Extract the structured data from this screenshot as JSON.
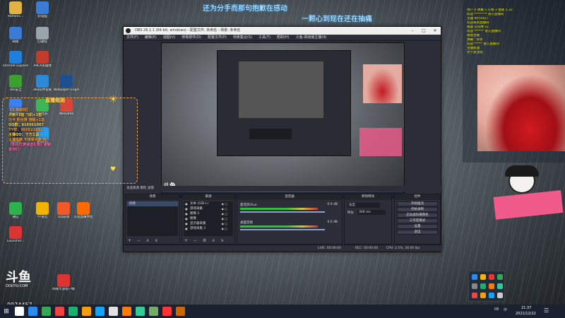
{
  "desktop": {
    "icons": [
      {
        "label": "Adminis…",
        "color": "#e3b341"
      },
      {
        "label": "此电脑",
        "color": "#3a7bd5"
      },
      {
        "label": "网络",
        "color": "#3a7bd5"
      },
      {
        "label": "回收站",
        "color": "#9aa4ad"
      },
      {
        "label": "Internet Explorer",
        "color": "#1e7fdc"
      },
      {
        "label": "APEX英雄地",
        "color": "#c23b2b"
      },
      {
        "label": "360安全",
        "color": "#3ba12e"
      },
      {
        "label": "360软件管家",
        "color": "#2d8ad8"
      },
      {
        "label": "Wallpaper Engine",
        "color": "#1d4f91"
      },
      {
        "label": "腾讯会议",
        "color": "#2f7bf0"
      },
      {
        "label": "QQ音乐",
        "color": "#33b34a"
      },
      {
        "label": "WeGame",
        "color": "#d43d2f"
      },
      {
        "label": "Steam",
        "color": "#1b2838"
      },
      {
        "label": "腾讯QQ",
        "color": "#1f97e8"
      },
      {
        "label": "微信",
        "color": "#2bb24c"
      },
      {
        "label": "YY语音",
        "color": "#f0b400"
      },
      {
        "label": "QQ游戏",
        "color": "#f05a28"
      },
      {
        "label": "斗鱼直播伴侣",
        "color": "#ff6a00"
      },
      {
        "label": "Launcher...",
        "color": "#d33"
      },
      {
        "label": "网易大游客户端",
        "color": "#d33"
      }
    ],
    "room_number": "9974457",
    "douyu_logo": "斗鱼",
    "douyu_url": "DOUYU.COM"
  },
  "lyrics": {
    "line1": "还为分手而那句抱歉在感动",
    "line2": "一颗心到现在还在抽痛"
  },
  "obs": {
    "title": "OBS 26.1.1 (64-bit, windows) - 配置文件: 未命名 - 场景: 未命名",
    "menu": [
      "文件(F)",
      "编辑(E)",
      "视图(V)",
      "停靠部件(D)",
      "配置文件(P)",
      "场景集合(S)",
      "工具(T)",
      "帮助(H)",
      "斗鱼-高级版主播(9)"
    ],
    "scene_bar": "未选择源    属性    滤镜",
    "docks": {
      "scenes": {
        "header": "场景",
        "items": [
          "场景"
        ]
      },
      "sources": {
        "header": "来源",
        "items": [
          "文本 (GDI+)",
          "游戏采集",
          "图像 2",
          "图像",
          "显示器采集",
          "游戏采集 2"
        ]
      },
      "mixer": {
        "header": "混音器",
        "ch1": "麦克风/Aux",
        "ch1_db": "0.0 dB",
        "ch2": "桌面音频",
        "ch2_db": "0.0 dB"
      },
      "transitions": {
        "header": "转场特效",
        "type": "淡出",
        "duration_label": "时长",
        "duration": "300 ms"
      },
      "controls": {
        "header": "控件",
        "buttons": [
          "开始推流",
          "开始录制",
          "启动虚拟摄像机",
          "工作室模式",
          "设置",
          "退出"
        ]
      }
    },
    "status": {
      "live": "LIVE: 00:00:00",
      "rec": "REC: 00:00:00",
      "cpu": "CPU: 2.1%, 30.00 fps"
    }
  },
  "overlay_note": {
    "title": "直播规则",
    "lines": [
      "【礼物规则】",
      "火箭+1首 飞机+1首",
      "办卡 粉丝牌 游艇+1首",
      "QQ群：916561007",
      "YY群：960522891",
      "主播QQ：下方工具",
      "主播唱歌 不接受点歌 哈",
      "【粉丝灯牌请送礼物】谢谢！",
      "爱你们！"
    ]
  },
  "chat": {
    "lines": [
      "用户 4   弹幕 5   礼物 3  金额 1.32",
      "欢迎 ******** 进入直播间",
      "主播 9974457",
      "欢迎来到直播间",
      "赠送 荧光棒 x1",
      "欢迎 ****** 进入直播间",
      "谢谢主播",
      "弹幕：好听",
      "欢迎 ***** 进入直播间",
      "主播加油",
      "点个关注吧"
    ]
  },
  "taskbar": {
    "time": "21:37",
    "date": "2021/12/22",
    "ime": "中",
    "weather": "08",
    "icons": [
      "#ffffff",
      "#2a8cf0",
      "#34a853",
      "#e44",
      "#1ab06e",
      "#f59e0b",
      "#12a4ff",
      "#e1e1e1",
      "#ff7a00",
      "#3c9",
      "#7a6",
      "#f33",
      "#c60"
    ]
  },
  "colors": {
    "accent": "#1ea0ff",
    "obs_bg": "#2b2e38"
  }
}
